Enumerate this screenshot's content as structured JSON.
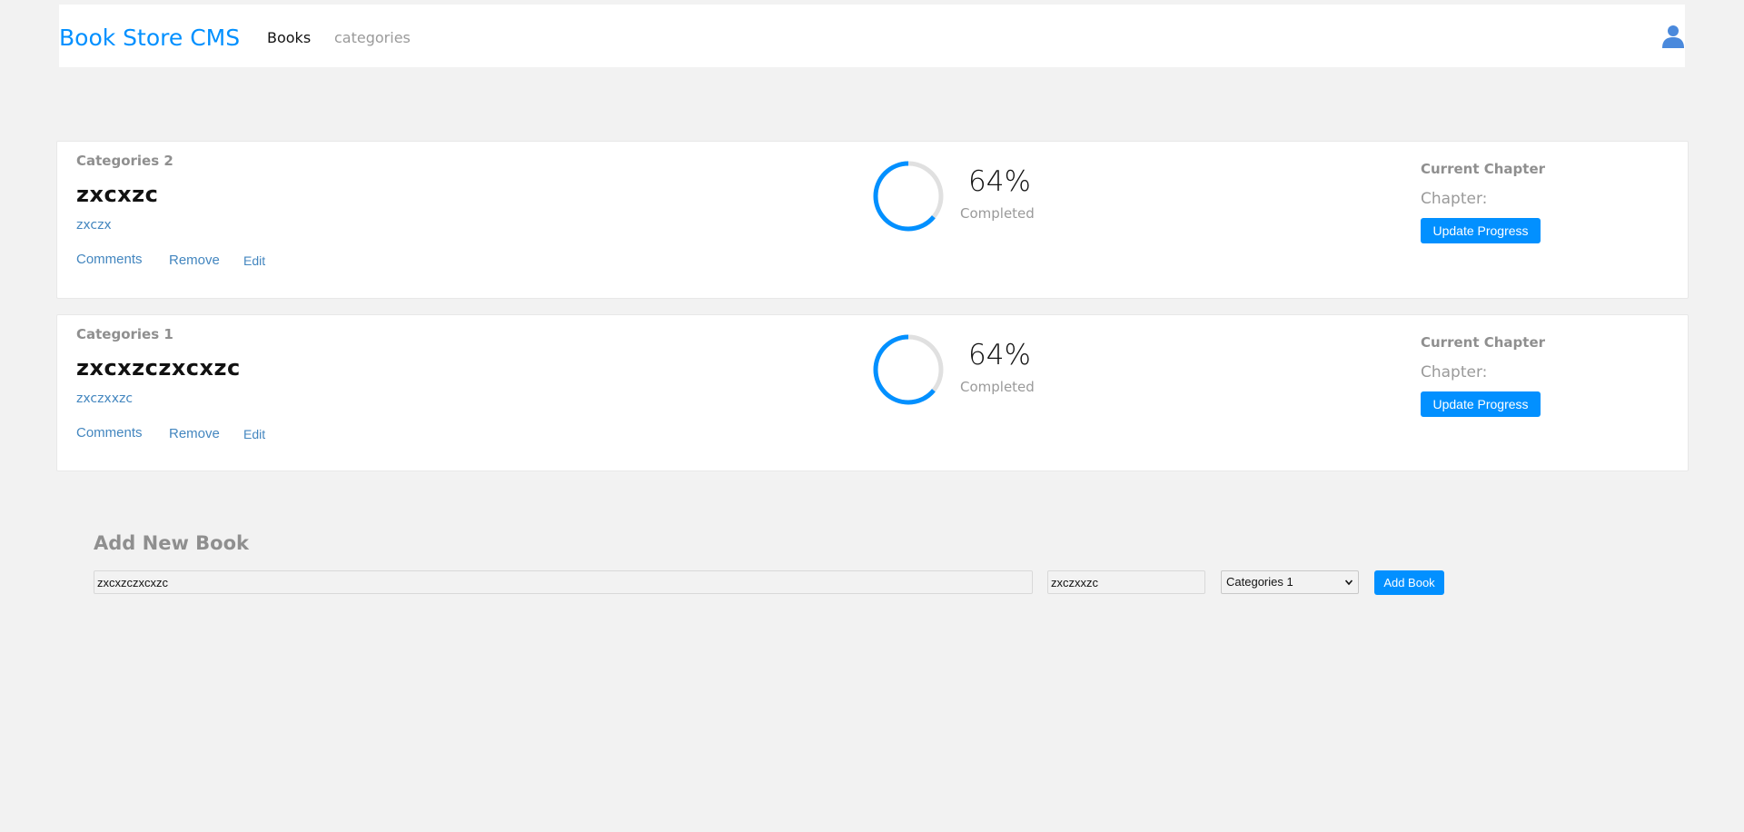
{
  "header": {
    "brand": "Book Store CMS",
    "nav": [
      {
        "label": "Books",
        "active": true
      },
      {
        "label": "categories",
        "active": false
      }
    ],
    "user_icon": "user-icon"
  },
  "books": [
    {
      "category": "Categories 2",
      "title": "zxcxzc",
      "author": "zxczx",
      "actions": {
        "comments": "Comments",
        "remove": "Remove",
        "edit": "Edit"
      },
      "progress": {
        "percent_label": "64%",
        "percent_value": 64,
        "completed_label": "Completed"
      },
      "chapter": {
        "heading": "Current Chapter",
        "label": "Chapter:",
        "button": "Update Progress"
      }
    },
    {
      "category": "Categories 1",
      "title": "zxcxzczxcxzc",
      "author": "zxczxxzc",
      "actions": {
        "comments": "Comments",
        "remove": "Remove",
        "edit": "Edit"
      },
      "progress": {
        "percent_label": "64%",
        "percent_value": 64,
        "completed_label": "Completed"
      },
      "chapter": {
        "heading": "Current Chapter",
        "label": "Chapter:",
        "button": "Update Progress"
      }
    }
  ],
  "add_book": {
    "heading": "Add New Book",
    "title_value": "zxcxzczxcxzc",
    "author_value": "zxczxxzc",
    "category_selected": "Categories 1",
    "button": "Add Book"
  },
  "colors": {
    "accent": "#0290ff",
    "background": "#f2f2f2",
    "link": "#4386bf",
    "ring_track": "#e8e8e8"
  }
}
